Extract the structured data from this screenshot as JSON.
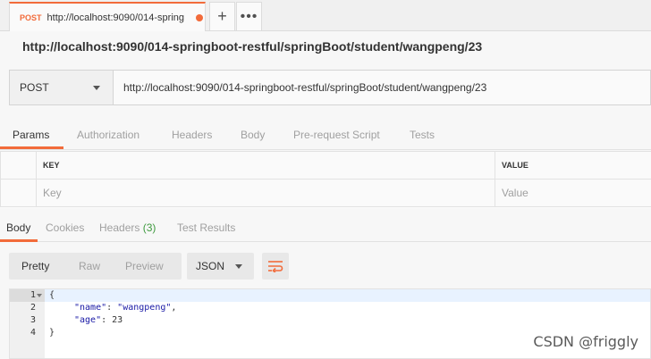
{
  "tab": {
    "method": "POST",
    "text": "http://localhost:9090/014-spring",
    "plus": "+",
    "more": "•••"
  },
  "title": "http://localhost:9090/014-springboot-restful/springBoot/student/wangpeng/23",
  "request": {
    "method": "POST",
    "url": "http://localhost:9090/014-springboot-restful/springBoot/student/wangpeng/23"
  },
  "subtabs": [
    "Params",
    "Authorization",
    "Headers",
    "Body",
    "Pre-request Script",
    "Tests"
  ],
  "params": {
    "key_header": "KEY",
    "value_header": "VALUE",
    "key_placeholder": "Key",
    "value_placeholder": "Value"
  },
  "response_tabs": {
    "body": "Body",
    "cookies": "Cookies",
    "headers": "Headers",
    "headers_count": "(3)",
    "test_results": "Test Results"
  },
  "view_modes": [
    "Pretty",
    "Raw",
    "Preview"
  ],
  "language": "JSON",
  "code": {
    "line_numbers": [
      "1",
      "2",
      "3",
      "4"
    ],
    "open": "{",
    "name_key": "\"name\"",
    "name_value": "\"wangpeng\"",
    "age_key": "\"age\"",
    "age_value": "23",
    "close": "}"
  },
  "watermark": "CSDN @friggly",
  "colors": {
    "accent": "#f26b3a",
    "count": "#3e9a3e"
  }
}
